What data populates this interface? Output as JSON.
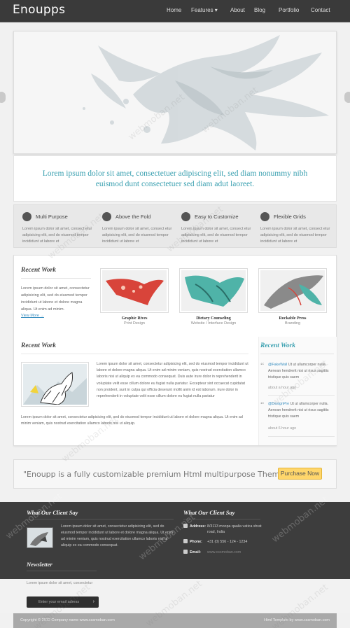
{
  "header": {
    "logo": "Enoupps",
    "nav": [
      "Home",
      "Features ▾",
      "About",
      "Blog",
      "Portfolio",
      "Contact"
    ]
  },
  "tagline": "Lorem ipsum dolor sit amet, consectetuer adipiscing elit, sed diam nonummy nibh euismod dunt consectetuer sed diam adut laoreet.",
  "features": [
    {
      "title": "Multi Purpose",
      "desc": "Lorem ipsum dolor sit amet, consect etur adipisicing elit, sed do eiusmod tempor incididunt ut labore et",
      "icon": "wrench-icon"
    },
    {
      "title": "Above the Fold",
      "desc": "Lorem ipsum dolor sit amet, consect etur adipisicing elit, sed do eiusmod tempor incididunt ut labore et",
      "icon": "window-icon"
    },
    {
      "title": "Easy to Customize",
      "desc": "Lorem ipsum dolor sit amet, consect etur adipisicing elit, sed do eiusmod tempor incididunt ut labore et",
      "icon": "gear-icon"
    },
    {
      "title": "Flexible Grids",
      "desc": "Lorem ipsum dolor sit amet, consect etur adipisicing elit, sed do eiusmod tempor incididunt ut labore et",
      "icon": "grid-icon"
    }
  ],
  "recent_work": {
    "title": "Recent Work",
    "text": "Lorem ipsum dolor sit amet, consectetur adipisicing elit, sed do eiusmod tempor incididunt ut labore et dolore magna aliqua. Ut enim ad minim.",
    "more": "View More →",
    "items": [
      {
        "name": "Graphic Rives",
        "category": "Print Design"
      },
      {
        "name": "Dietary Counseling",
        "category": "Website / Interface Design"
      },
      {
        "name": "Rockable Press",
        "category": "Branding"
      }
    ]
  },
  "recent_work_2": {
    "title": "Recent Work",
    "text1": "Lorem ipsum dolor sit amet, consectetur adipisicing elit, sed do eiusmod tempor incididunt ut labore et dolore magna aliqua. Ut enim ad minim veniam, quis nostrud exercitation ullamco laboris nisi ut aliquip ex ea commodo consequat. Duis aute irure dolor in reprehenderit in voluptate velit esse cillum dolore eu fugiat nulla pariatur. Excepteur sint occaecat cupidatat non proident, sunt in culpa qui officia deserunt mollit anim id est laborum. irure dolor in reprehenderit in voluptate velit esse cillum dolore eu fugiat nulla pariatur",
    "text2": "Lorem ipsum dolor sit amet, consectetur adipisicing elit, sed do eiusmod tempor incididunt ut labore et dolore magna aliqua. Ut enim ad minim veniam, quis nostrud exercitation ullamco laboris nisi ut aliquip."
  },
  "sidebar": {
    "title": "Recent Work",
    "tweets": [
      {
        "handle": "@FakeWall",
        "text": " Ut ut ullamcorper nulla. Aenean hendrerit nisi ut risus sagittis tristique quis saem",
        "ago": "about a hour ago"
      },
      {
        "handle": "@DesignPre",
        "text": " Ut ut ullamcorper nulla. Aenean hendrerit nisi ut risus sagittis tristique quis saem",
        "ago": "about 6 hour ago"
      }
    ]
  },
  "cta": {
    "text": "\"Enoupp is a fully customizable premium Html multipurpose Theme\"",
    "button": "Purchase Now"
  },
  "footer": {
    "clients_title": "What Our Client Say",
    "clients_text": "Lorem ipsum dolor sit amet, consectetur adipisicing elit, sed do eiusmod tempor incididunt ut labore et dolore magna aliqua. Ut enim ad minim veniam, quis nostrud exercitation ullamco laboris nisi ut aliquip ex ea commodo consequat.",
    "contact_title": "What Our Client Say",
    "contact": [
      {
        "label": "Address:",
        "value": "8/3113 moopa qaalia vatica shrat road, India",
        "icon": "location-icon"
      },
      {
        "label": "Phone:",
        "value": "+31 (0) 556 - 124 - 1234",
        "icon": "phone-icon"
      },
      {
        "label": "Email:",
        "value": "www.cssmoban.com",
        "icon": "mail-icon"
      }
    ],
    "newsletter_title": "Newsletter",
    "newsletter_desc": "Lorem ipsum dolor sit amet, consectetur",
    "newsletter_placeholder": "Enter your email adress",
    "copyright_left": "Copyright © 2012 Company name  www.cssmoban.com",
    "copyright_right": "Html Template by www.cssmoban.com"
  },
  "watermark": "webmoban.net",
  "colors": {
    "accent": "#3aa0b0",
    "header_bg": "#3a3a3a",
    "footer_bg": "#3d3d3d",
    "button": "#ffd66b",
    "link": "#3a8fc0"
  }
}
